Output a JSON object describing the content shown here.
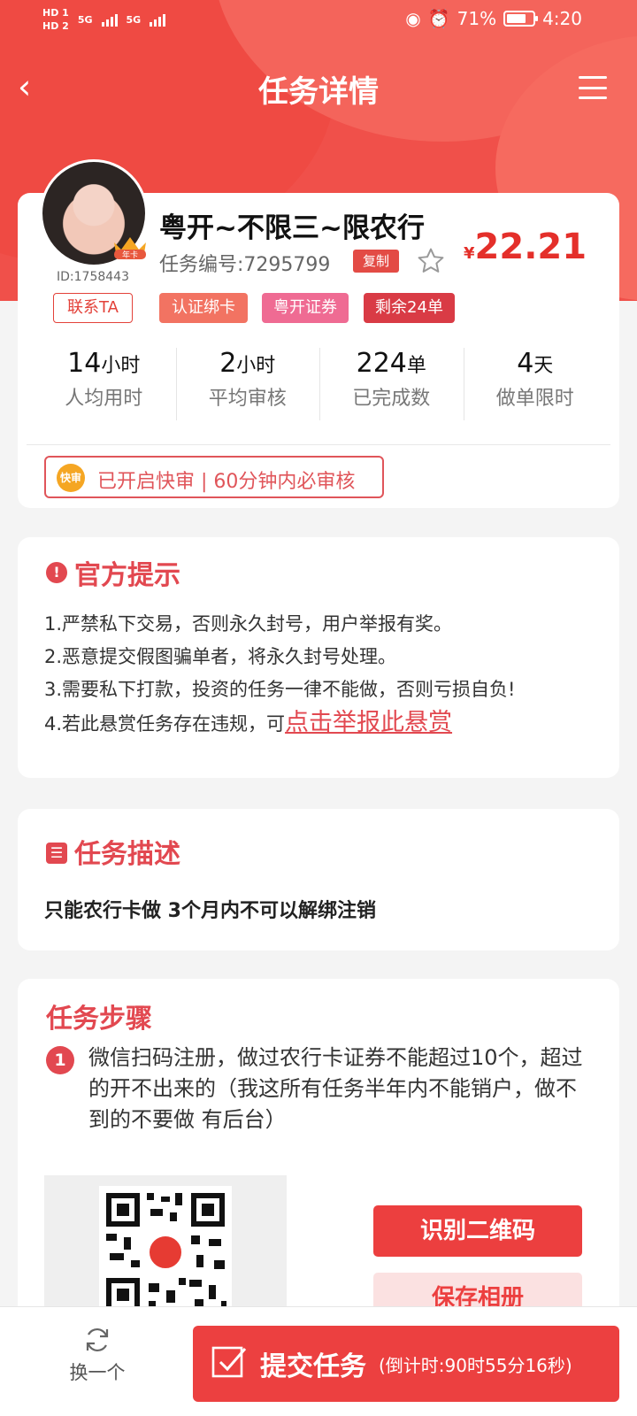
{
  "status_bar": {
    "left_labels": [
      "HD 1",
      "HD 2",
      "5G",
      "5G"
    ],
    "battery": "71%",
    "time": "4:20"
  },
  "nav": {
    "title": "任务详情"
  },
  "task": {
    "user_id": "ID:1758443",
    "contact_label": "联系TA",
    "vip_badge": "年卡",
    "name": "粤开~不限三~限农行",
    "number": "任务编号:7295799",
    "copy_label": "复制",
    "price_symbol": "¥",
    "price": "22.21",
    "tags": [
      "认证绑卡",
      "粤开证券",
      "剩余24单"
    ]
  },
  "stats": [
    {
      "value": "14",
      "unit": "小时",
      "label": "人均用时"
    },
    {
      "value": "2",
      "unit": "小时",
      "label": "平均审核"
    },
    {
      "value": "224",
      "unit": "单",
      "label": "已完成数"
    },
    {
      "value": "4",
      "unit": "天",
      "label": "做单限时"
    }
  ],
  "fast_review": {
    "badge": "快审",
    "text": "已开启快审 | 60分钟内必审核"
  },
  "notice": {
    "title": "官方提示",
    "lines": [
      "1.严禁私下交易，否则永久封号，用户举报有奖。",
      "2.恶意提交假图骗单者，将永久封号处理。",
      "3.需要私下打款，投资的任务一律不能做，否则亏损自负!",
      "4.若此悬赏任务存在违规，可"
    ],
    "report_link": "点击举报此悬赏"
  },
  "description": {
    "title": "任务描述",
    "text": "只能农行卡做  3个月内不可以解绑注销"
  },
  "steps": {
    "title": "任务步骤",
    "step1_number": "1",
    "step1_text": "微信扫码注册，做过农行卡证券不能超过10个，超过的开不出来的（我这所有任务半年内不能销户，做不到的不要做 有后台）",
    "scan_button": "识别二维码",
    "save_button": "保存相册"
  },
  "bottom_bar": {
    "swap_label": "换一个",
    "submit_label": "提交任务",
    "countdown": "(倒计时:90时55分16秒)"
  }
}
